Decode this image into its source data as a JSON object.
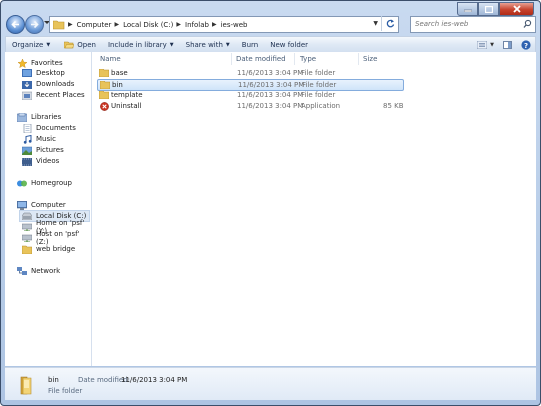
{
  "window": {
    "caption": {
      "minimize": "minimize-icon",
      "maximize": "maximize-icon",
      "close": "close-icon"
    }
  },
  "address": {
    "crumbs": [
      "Computer",
      "Local Disk (C:)",
      "Infolab",
      "ies-web"
    ]
  },
  "search": {
    "placeholder": "Search ies-web"
  },
  "toolbar": {
    "organize": "Organize",
    "open": "Open",
    "include": "Include in library",
    "share": "Share with",
    "burn": "Burn",
    "new_folder": "New folder"
  },
  "nav": {
    "favorites": "Favorites",
    "desktop": "Desktop",
    "downloads": "Downloads",
    "recent": "Recent Places",
    "libraries": "Libraries",
    "documents": "Documents",
    "music": "Music",
    "pictures": "Pictures",
    "videos": "Videos",
    "homegroup": "Homegroup",
    "computer": "Computer",
    "local_disk": "Local Disk (C:)",
    "home_psf": "Home on 'psf' (Y:)",
    "host_psf": "Host on 'psf' (Z:)",
    "web_bridge": "web bridge",
    "network": "Network"
  },
  "columns": {
    "name": "Name",
    "date": "Date modified",
    "type": "Type",
    "size": "Size"
  },
  "files": [
    {
      "name": "base",
      "date": "11/6/2013 3:04 PM",
      "type": "File folder",
      "size": ""
    },
    {
      "name": "bin",
      "date": "11/6/2013 3:04 PM",
      "type": "File folder",
      "size": ""
    },
    {
      "name": "template",
      "date": "11/6/2013 3:04 PM",
      "type": "File folder",
      "size": ""
    },
    {
      "name": "Uninstall",
      "date": "11/6/2013 3:04 PM",
      "type": "Application",
      "size": "85 KB"
    }
  ],
  "selected_index": 1,
  "details": {
    "name": "bin",
    "date_label": "Date modified:",
    "date_value": "11/6/2013 3:04 PM",
    "type": "File folder"
  },
  "colors": {
    "folder": "#e8c35a",
    "selection": "#cfe4f9",
    "chrome": "#c9daf0"
  }
}
